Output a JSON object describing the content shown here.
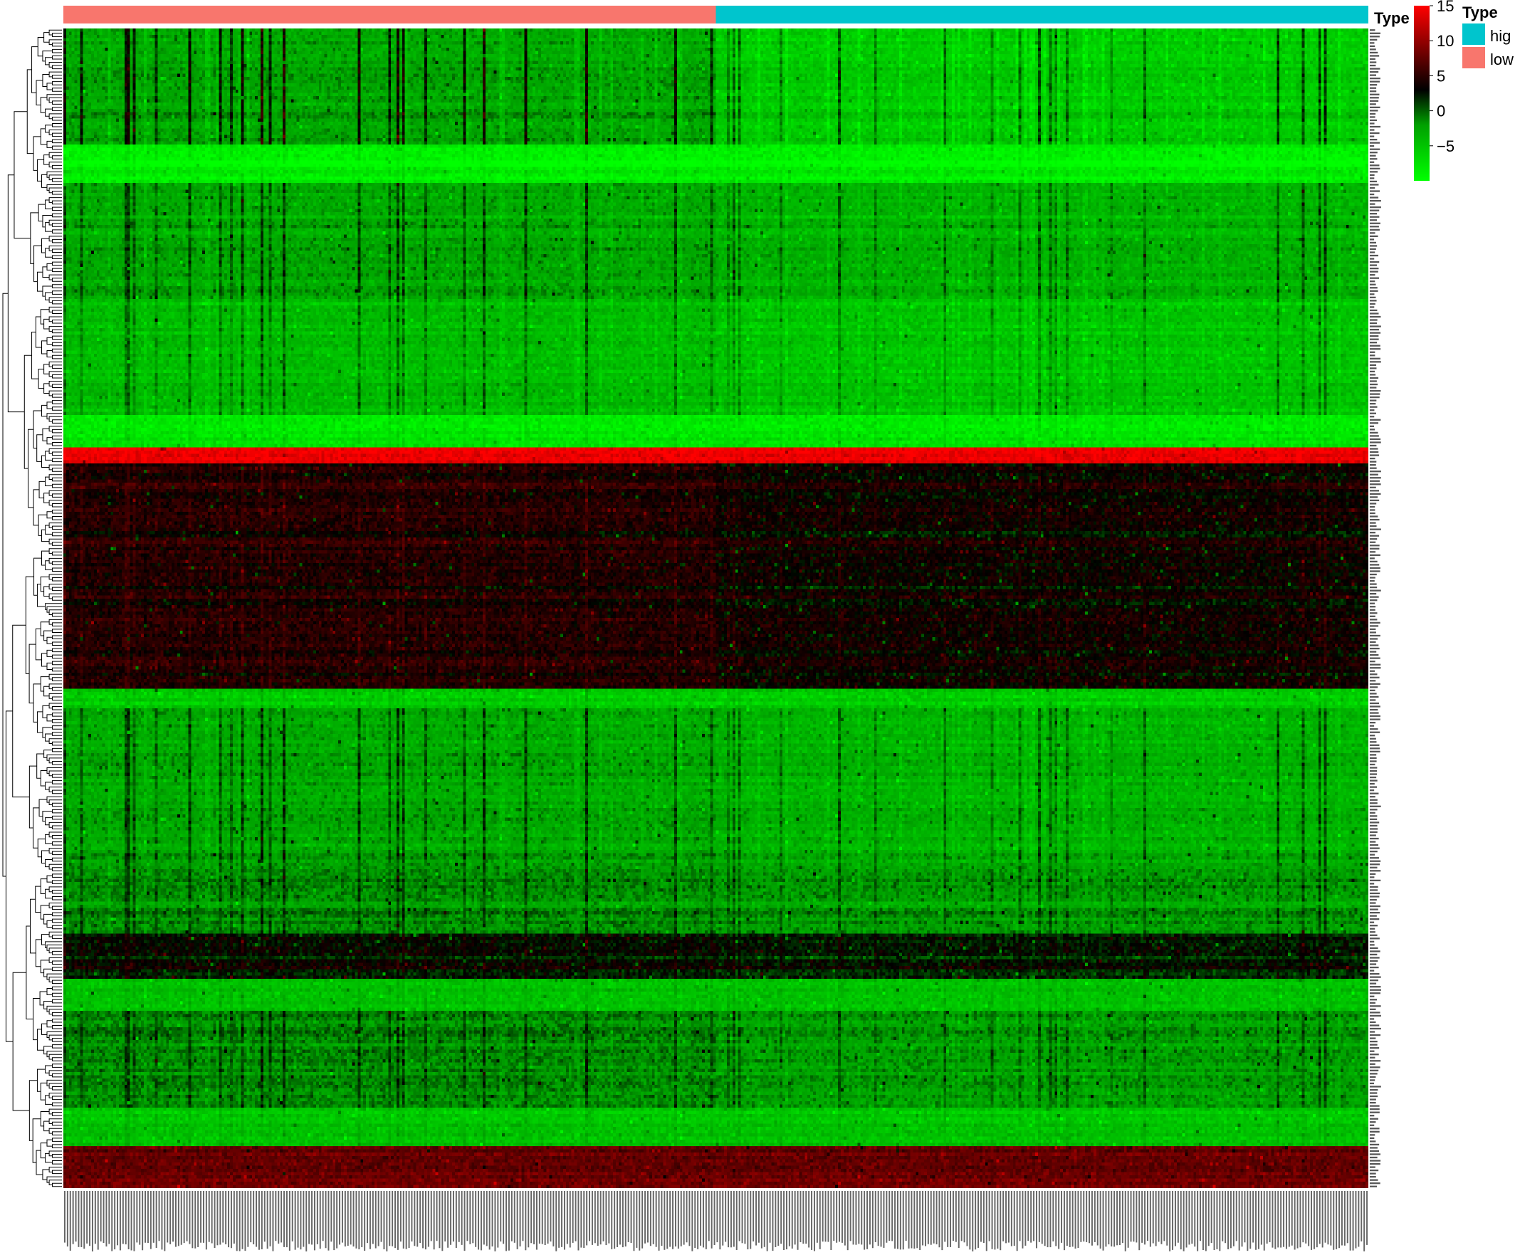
{
  "chart_data": {
    "type": "heatmap",
    "annotation": {
      "title": "Type",
      "groups": [
        {
          "label": "low",
          "color": "#F8766D",
          "samples": 235
        },
        {
          "label": "hig",
          "color": "#00C5CD",
          "samples": 235
        }
      ]
    },
    "legend": {
      "title": "Type",
      "placement": "right",
      "items": [
        {
          "label": "hig",
          "color": "#00C5CD"
        },
        {
          "label": "low",
          "color": "#F8766D"
        }
      ]
    },
    "color_scale": {
      "min": -10,
      "max": 15,
      "ticks": [
        15,
        10,
        5,
        0,
        -5
      ],
      "tick_labels": [
        "15",
        "10",
        "5",
        "0",
        "−5"
      ],
      "stops": [
        {
          "value": -10,
          "color": "#00FF00"
        },
        {
          "value": -2,
          "color": "#00A000"
        },
        {
          "value": 3,
          "color": "#000000"
        },
        {
          "value": 15,
          "color": "#FF0000"
        }
      ]
    },
    "n_columns": 470,
    "n_rows": 360,
    "row_dendrogram": true,
    "column_dendrogram": false,
    "row_blocks": [
      {
        "rows": 36,
        "mean": -5.5,
        "low_group_shift": 3.0,
        "dark_column_bias": 5
      },
      {
        "rows": 12,
        "mean": -9.0,
        "low_group_shift": 0.0,
        "dark_column_bias": 1
      },
      {
        "rows": 36,
        "mean": -3.5,
        "low_group_shift": 0.8,
        "dark_column_bias": 3
      },
      {
        "rows": 36,
        "mean": -5.0,
        "low_group_shift": 0.8,
        "dark_column_bias": 3
      },
      {
        "rows": 10,
        "mean": -8.0,
        "low_group_shift": 0.0,
        "dark_column_bias": 1
      },
      {
        "rows": 5,
        "mean": 14.0,
        "low_group_shift": 0.0,
        "dark_column_bias": 0
      },
      {
        "rows": 70,
        "mean": 3.5,
        "low_group_shift": 1.0,
        "dark_column_bias": 1
      },
      {
        "rows": 6,
        "mean": -5.5,
        "low_group_shift": 0.0,
        "dark_column_bias": 1
      },
      {
        "rows": 48,
        "mean": -3.5,
        "low_group_shift": 0.8,
        "dark_column_bias": 3
      },
      {
        "rows": 22,
        "mean": -2.0,
        "low_group_shift": 0.5,
        "dark_column_bias": 2
      },
      {
        "rows": 14,
        "mean": 2.5,
        "low_group_shift": 0.5,
        "dark_column_bias": 1
      },
      {
        "rows": 10,
        "mean": -5.0,
        "low_group_shift": 0.0,
        "dark_column_bias": 1
      },
      {
        "rows": 30,
        "mean": -2.0,
        "low_group_shift": 0.8,
        "dark_column_bias": 2
      },
      {
        "rows": 12,
        "mean": -5.0,
        "low_group_shift": 0.0,
        "dark_column_bias": 1
      },
      {
        "rows": 22,
        "mean": 8.0,
        "low_group_shift": 0.0,
        "dark_column_bias": 0
      },
      {
        "rows": 3,
        "mean": -6.0,
        "low_group_shift": 0.0,
        "dark_column_bias": 0
      }
    ]
  }
}
